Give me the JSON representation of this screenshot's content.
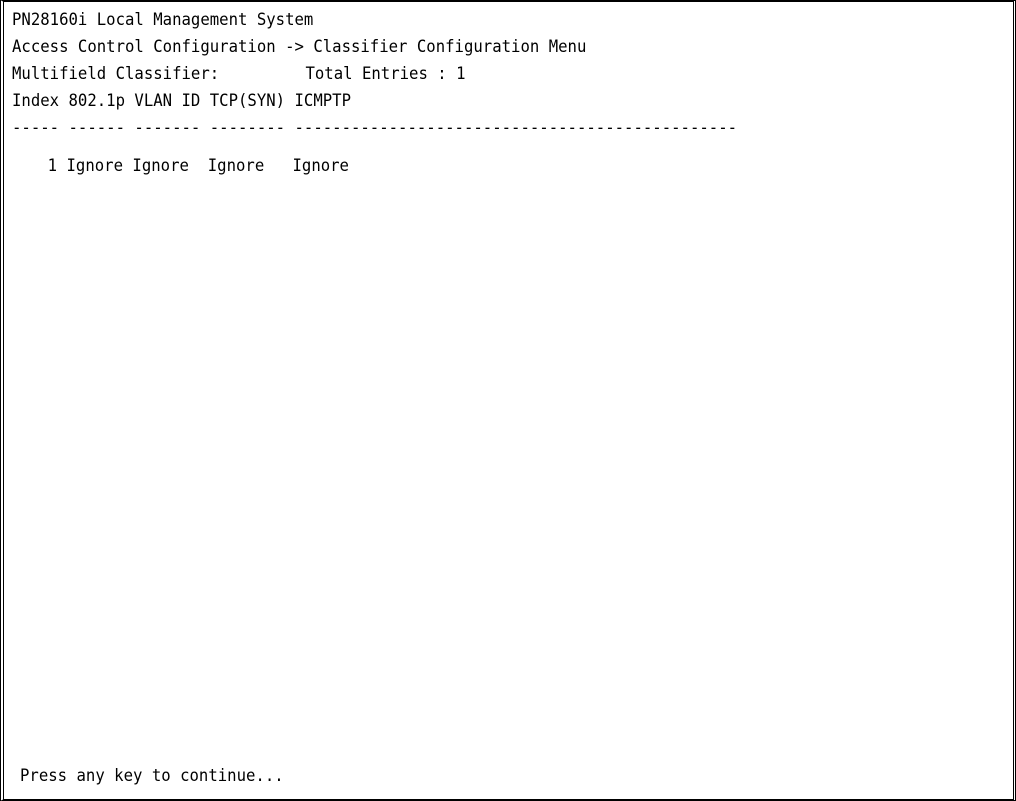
{
  "terminal": {
    "title": "PN28160i Local Management System",
    "menu_path": "Access Control Configuration -> Classifier Configuration Menu",
    "summary": {
      "label": "Multifield Classifier:",
      "total_entries_label": "Total Entries : 1"
    },
    "table": {
      "header_line": "Index 802.1p VLAN ID TCP(SYN) ICMPTP",
      "separator_line": "----- ------ ------- -------- -----------------------------------------------",
      "rows": [
        {
          "index": "1",
          "cells_text": " Ignore Ignore  Ignore   Ignore"
        }
      ]
    },
    "prompt": "Press any key to continue..."
  }
}
